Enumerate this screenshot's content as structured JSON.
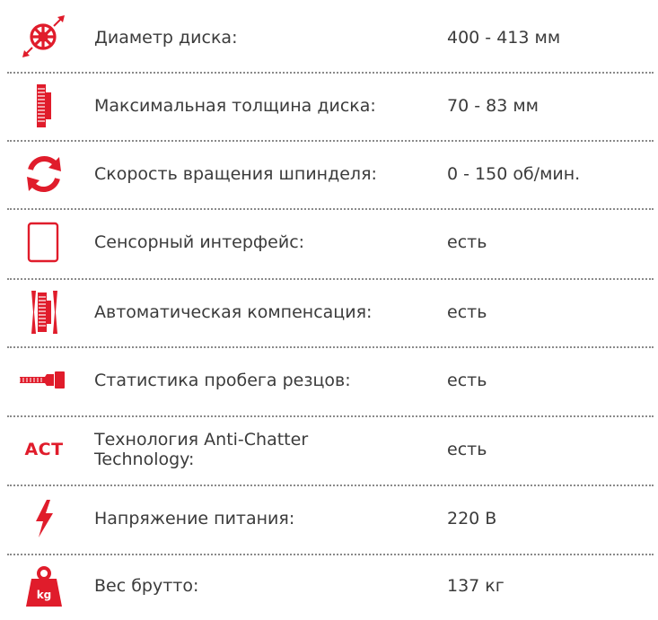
{
  "theme": {
    "accent": "#e01c2b",
    "text": "#3b3b3b",
    "separator": "#8a8a8a"
  },
  "specs": [
    {
      "label": "Диаметр диска:",
      "value": "400 - 413 мм",
      "icon": "disc-diameter-icon"
    },
    {
      "label": "Максимальная толщина диска:",
      "value": "70 - 83 мм",
      "icon": "disc-thickness-icon"
    },
    {
      "label": "Скорость вращения шпинделя:",
      "value": "0 - 150 об/мин.",
      "icon": "rotation-speed-icon"
    },
    {
      "label": "Сенсорный интерфейс:",
      "value": "есть",
      "icon": "touchscreen-icon"
    },
    {
      "label": "Автоматическая компенсация:",
      "value": "есть",
      "icon": "auto-compensation-icon"
    },
    {
      "label": "Статистика пробега резцов:",
      "value": "есть",
      "icon": "cutter-mileage-icon"
    },
    {
      "label": "Технология Anti-Chatter Technology:",
      "value": "есть",
      "icon": "act-icon",
      "icon_text": "ACT"
    },
    {
      "label": "Напряжение питания:",
      "value": "220 В",
      "icon": "lightning-icon"
    },
    {
      "label": "Вес брутто:",
      "value": "137 кг",
      "icon": "weight-kg-icon",
      "icon_text": "kg"
    }
  ]
}
